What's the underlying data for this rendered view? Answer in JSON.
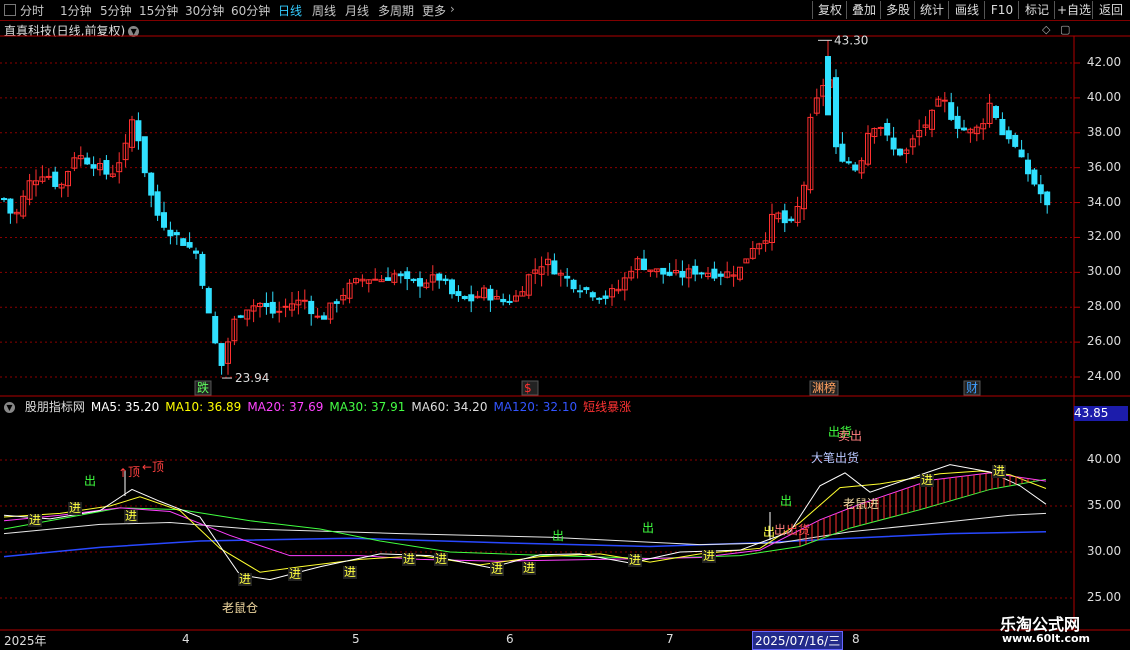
{
  "toolbar": {
    "tabs": [
      "分时",
      "1分钟",
      "5分钟",
      "15分钟",
      "30分钟",
      "60分钟",
      "日线",
      "周线",
      "月线",
      "多周期",
      "更多"
    ],
    "active_tab": "日线",
    "right_buttons": [
      "复权",
      "叠加",
      "多股",
      "统计",
      "画线",
      "F10",
      "标记",
      "+自选",
      "返回"
    ]
  },
  "main_header": {
    "title": "直真科技(日线,前复权)"
  },
  "price_axis": [
    "42.00",
    "40.00",
    "38.00",
    "36.00",
    "34.00",
    "32.00",
    "30.00",
    "28.00",
    "26.00",
    "24.00"
  ],
  "price_annotations": {
    "high": "43.30",
    "low": "23.94"
  },
  "event_markers": [
    {
      "text": "跌",
      "color": "#60ff60"
    },
    {
      "text": "$",
      "color": "#ff3030"
    },
    {
      "text": "渊榜",
      "color": "#ffa060"
    },
    {
      "text": "财",
      "color": "#40a0ff"
    }
  ],
  "indicator_header": {
    "name": "股朋指标网",
    "items": [
      {
        "label": "MA5: 35.20",
        "color": "#ffffff"
      },
      {
        "label": "MA10: 36.89",
        "color": "#ffff00"
      },
      {
        "label": "MA20: 37.69",
        "color": "#ff40ff"
      },
      {
        "label": "MA30: 37.91",
        "color": "#40ff40"
      },
      {
        "label": "MA60: 34.20",
        "color": "#dddddd"
      },
      {
        "label": "MA120: 32.10",
        "color": "#3050ff"
      },
      {
        "label": "短线暴涨",
        "color": "#ff3030"
      }
    ]
  },
  "indicator_axis": [
    "40.00",
    "35.00",
    "30.00",
    "25.00"
  ],
  "indicator_badge": "43.85",
  "indicator_annotations": {
    "jin": "进",
    "chu": "出",
    "ding": "顶",
    "laoshucang": "老鼠仓",
    "dabi": "大笔出货",
    "laoshujin": "老鼠进",
    "chuhuo": "出货",
    "maichu": "卖出"
  },
  "time_axis": [
    "2025年",
    "4",
    "5",
    "6",
    "7",
    "8"
  ],
  "cursor_date": "2025/07/16/三",
  "watermark": {
    "title": "乐淘公式网",
    "url": "www.60lt.com"
  },
  "colors": {
    "up": "#ff3030",
    "down": "#30e0ff",
    "grid": "#8b0000",
    "frame": "#b00000"
  }
}
